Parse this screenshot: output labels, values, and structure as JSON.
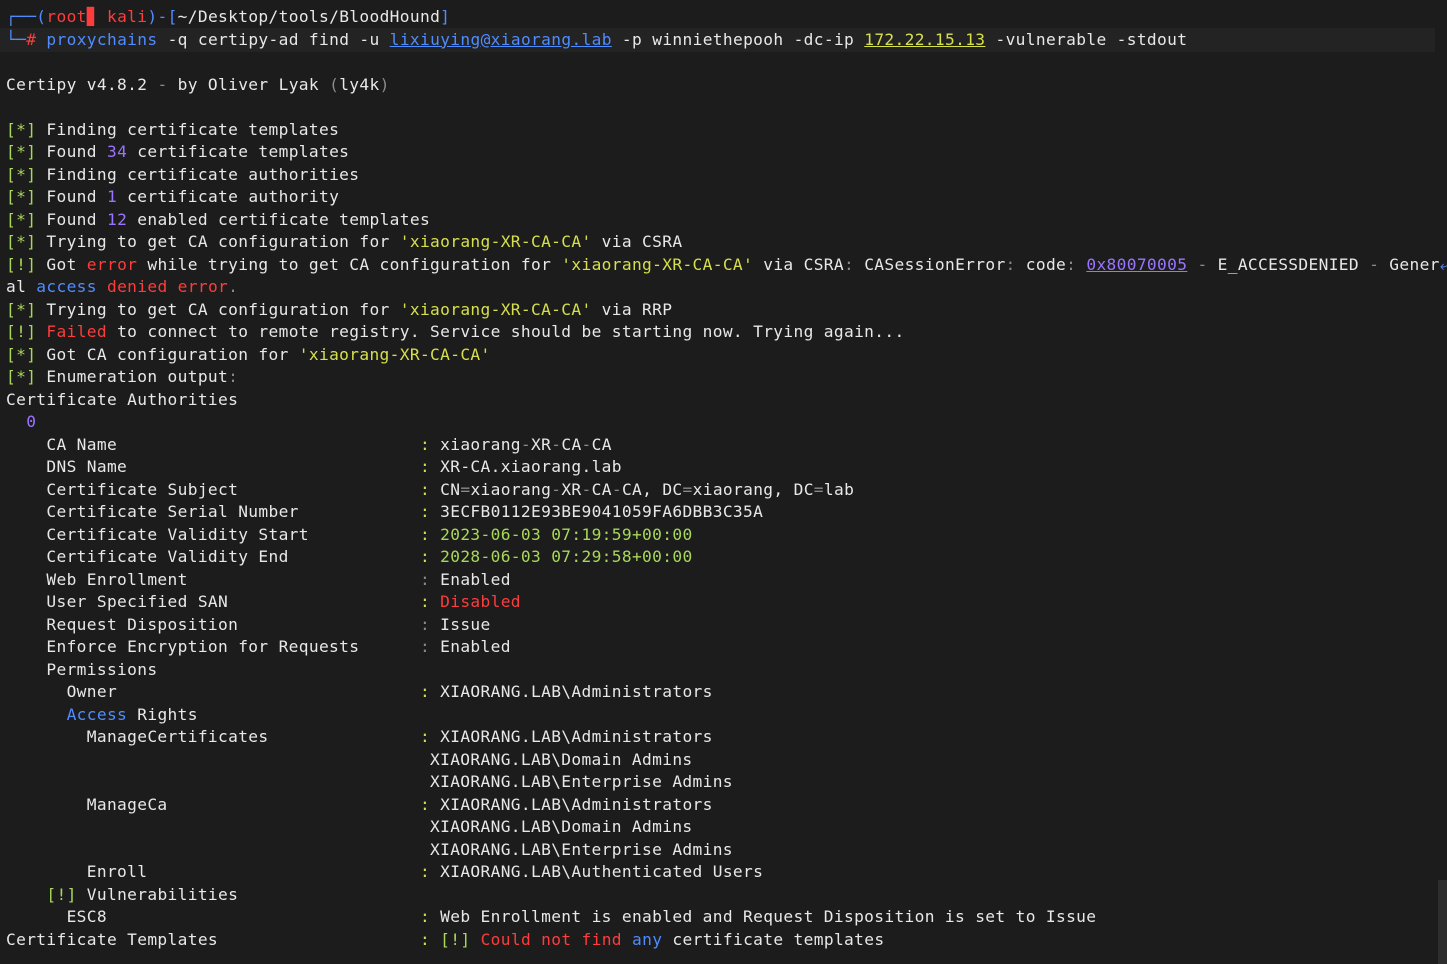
{
  "colors": {
    "background": "#1c1c1c",
    "foreground": "#e8e8e8",
    "blue": "#4f8cff",
    "green": "#a8d85a",
    "red": "#ff3c3c",
    "yellow": "#d6e04a",
    "purple": "#9a74ff",
    "gray": "#8a8a8a"
  },
  "terminal": {
    "lines": [
      [
        {
          "t": "┌──(",
          "c": "blue"
        },
        {
          "t": "root",
          "c": "red"
        },
        {
          "t": "▊",
          "c": "red"
        },
        {
          "t": " kali",
          "c": "red"
        },
        {
          "t": ")-[",
          "c": "blue"
        },
        {
          "t": "~/Desktop/tools/BloodHound",
          "c": "fg"
        },
        {
          "t": "]",
          "c": "blue"
        }
      ],
      [
        {
          "t": "└─",
          "c": "blue"
        },
        {
          "t": "# ",
          "c": "red"
        },
        {
          "t": "proxychains",
          "c": "blue"
        },
        {
          "t": " -q ",
          "c": "fg"
        },
        {
          "t": "certipy-ad",
          "c": "fg"
        },
        {
          "t": " find ",
          "c": "fg"
        },
        {
          "t": "-u",
          "c": "fg"
        },
        {
          "t": " ",
          "c": "fg"
        },
        {
          "t": "lixiuying@xiaorang.lab",
          "c": "blue",
          "u": true
        },
        {
          "t": " -p ",
          "c": "fg"
        },
        {
          "t": "winniethepooh",
          "c": "fg"
        },
        {
          "t": " -dc-ip ",
          "c": "fg"
        },
        {
          "t": "172.22.15.13",
          "c": "yellow",
          "u": true
        },
        {
          "t": " -vulnerable -stdout",
          "c": "fg"
        }
      ],
      [],
      [
        {
          "t": "Certipy v4.8.2 ",
          "c": "fg"
        },
        {
          "t": "-",
          "c": "gray"
        },
        {
          "t": " by Oliver Lyak ",
          "c": "fg"
        },
        {
          "t": "(",
          "c": "gray"
        },
        {
          "t": "ly4k",
          "c": "fg"
        },
        {
          "t": ")",
          "c": "gray"
        }
      ],
      [],
      [
        {
          "t": "[*]",
          "c": "green"
        },
        {
          "t": " Finding certificate templates",
          "c": "fg"
        }
      ],
      [
        {
          "t": "[*]",
          "c": "green"
        },
        {
          "t": " Found ",
          "c": "fg"
        },
        {
          "t": "34",
          "c": "purple"
        },
        {
          "t": " certificate templates",
          "c": "fg"
        }
      ],
      [
        {
          "t": "[*]",
          "c": "green"
        },
        {
          "t": " Finding certificate authorities",
          "c": "fg"
        }
      ],
      [
        {
          "t": "[*]",
          "c": "green"
        },
        {
          "t": " Found ",
          "c": "fg"
        },
        {
          "t": "1",
          "c": "purple"
        },
        {
          "t": " certificate authority",
          "c": "fg"
        }
      ],
      [
        {
          "t": "[*]",
          "c": "green"
        },
        {
          "t": " Found ",
          "c": "fg"
        },
        {
          "t": "12",
          "c": "purple"
        },
        {
          "t": " enabled certificate templates",
          "c": "fg"
        }
      ],
      [
        {
          "t": "[*]",
          "c": "green"
        },
        {
          "t": " Trying to get CA configuration for ",
          "c": "fg"
        },
        {
          "t": "'xiaorang-XR-CA-CA'",
          "c": "yellow"
        },
        {
          "t": " via CSRA",
          "c": "fg"
        }
      ],
      [
        {
          "t": "[!]",
          "c": "green"
        },
        {
          "t": " Got ",
          "c": "fg"
        },
        {
          "t": "error",
          "c": "red"
        },
        {
          "t": " while trying to get CA configuration for ",
          "c": "fg"
        },
        {
          "t": "'xiaorang-XR-CA-CA'",
          "c": "yellow"
        },
        {
          "t": " via CSRA",
          "c": "fg"
        },
        {
          "t": ":",
          "c": "gray"
        },
        {
          "t": " CASessionError",
          "c": "fg"
        },
        {
          "t": ":",
          "c": "gray"
        },
        {
          "t": " code",
          "c": "fg"
        },
        {
          "t": ":",
          "c": "gray"
        },
        {
          "t": " ",
          "c": "fg"
        },
        {
          "t": "0x80070005",
          "c": "purple",
          "u": true
        },
        {
          "t": " ",
          "c": "fg"
        },
        {
          "t": "-",
          "c": "gray"
        },
        {
          "t": " E_ACCESSDENIED ",
          "c": "fg"
        },
        {
          "t": "-",
          "c": "gray"
        },
        {
          "t": " Gener",
          "c": "fg"
        },
        {
          "t": "⤶",
          "c": "blue"
        }
      ],
      [
        {
          "t": "al ",
          "c": "fg"
        },
        {
          "t": "access",
          "c": "blue"
        },
        {
          "t": " ",
          "c": "fg"
        },
        {
          "t": "denied",
          "c": "red"
        },
        {
          "t": " ",
          "c": "fg"
        },
        {
          "t": "error",
          "c": "red"
        },
        {
          "t": ".",
          "c": "gray"
        }
      ],
      [
        {
          "t": "[*]",
          "c": "green"
        },
        {
          "t": " Trying to get CA configuration for ",
          "c": "fg"
        },
        {
          "t": "'xiaorang-XR-CA-CA'",
          "c": "yellow"
        },
        {
          "t": " via RRP",
          "c": "fg"
        }
      ],
      [
        {
          "t": "[!]",
          "c": "green"
        },
        {
          "t": " ",
          "c": "fg"
        },
        {
          "t": "Failed",
          "c": "red"
        },
        {
          "t": " to connect to remote registry. Service should be starting now. Trying again...",
          "c": "fg"
        }
      ],
      [
        {
          "t": "[*]",
          "c": "green"
        },
        {
          "t": " Got CA configuration for ",
          "c": "fg"
        },
        {
          "t": "'xiaorang-XR-CA-CA'",
          "c": "yellow"
        }
      ],
      [
        {
          "t": "[*]",
          "c": "green"
        },
        {
          "t": " Enumeration output",
          "c": "fg"
        },
        {
          "t": ":",
          "c": "gray"
        }
      ],
      [
        {
          "t": "Certificate Authorities",
          "c": "fg"
        }
      ],
      [
        {
          "t": "  ",
          "c": "fg"
        },
        {
          "t": "0",
          "c": "purple"
        }
      ],
      [
        {
          "t": "    CA Name                              ",
          "c": "fg"
        },
        {
          "t": ":",
          "c": "yellow"
        },
        {
          "t": " xiaorang",
          "c": "fg"
        },
        {
          "t": "-",
          "c": "gray"
        },
        {
          "t": "XR",
          "c": "fg"
        },
        {
          "t": "-",
          "c": "gray"
        },
        {
          "t": "CA",
          "c": "fg"
        },
        {
          "t": "-",
          "c": "gray"
        },
        {
          "t": "CA",
          "c": "fg"
        }
      ],
      [
        {
          "t": "    DNS Name                             ",
          "c": "fg"
        },
        {
          "t": ":",
          "c": "yellow"
        },
        {
          "t": " XR-CA.xiaorang.lab",
          "c": "fg"
        }
      ],
      [
        {
          "t": "    Certificate Subject                  ",
          "c": "fg"
        },
        {
          "t": ":",
          "c": "yellow"
        },
        {
          "t": " CN",
          "c": "fg"
        },
        {
          "t": "=",
          "c": "gray"
        },
        {
          "t": "xiaorang",
          "c": "fg"
        },
        {
          "t": "-",
          "c": "gray"
        },
        {
          "t": "XR",
          "c": "fg"
        },
        {
          "t": "-",
          "c": "gray"
        },
        {
          "t": "CA",
          "c": "fg"
        },
        {
          "t": "-",
          "c": "gray"
        },
        {
          "t": "CA, DC",
          "c": "fg"
        },
        {
          "t": "=",
          "c": "gray"
        },
        {
          "t": "xiaorang, DC",
          "c": "fg"
        },
        {
          "t": "=",
          "c": "gray"
        },
        {
          "t": "lab",
          "c": "fg"
        }
      ],
      [
        {
          "t": "    Certificate Serial Number            ",
          "c": "fg"
        },
        {
          "t": ":",
          "c": "yellow"
        },
        {
          "t": " 3ECFB0112E93BE9041059FA6DBB3C35A",
          "c": "fg"
        }
      ],
      [
        {
          "t": "    Certificate Validity Start           ",
          "c": "fg"
        },
        {
          "t": ":",
          "c": "yellow"
        },
        {
          "t": " 2023-06-03 07:19:59+00:00",
          "c": "green"
        }
      ],
      [
        {
          "t": "    Certificate Validity End             ",
          "c": "fg"
        },
        {
          "t": ":",
          "c": "yellow"
        },
        {
          "t": " 2028-06-03 07:29:58+00:00",
          "c": "green"
        }
      ],
      [
        {
          "t": "    Web Enrollment                       ",
          "c": "fg"
        },
        {
          "t": ":",
          "c": "gray"
        },
        {
          "t": " Enabled",
          "c": "fg"
        }
      ],
      [
        {
          "t": "    User Specified SAN                   ",
          "c": "fg"
        },
        {
          "t": ":",
          "c": "yellow"
        },
        {
          "t": " Disabled",
          "c": "red"
        }
      ],
      [
        {
          "t": "    Request Disposition                  ",
          "c": "fg"
        },
        {
          "t": ":",
          "c": "gray"
        },
        {
          "t": " Issue",
          "c": "fg"
        }
      ],
      [
        {
          "t": "    Enforce Encryption for Requests      ",
          "c": "fg"
        },
        {
          "t": ":",
          "c": "gray"
        },
        {
          "t": " Enabled",
          "c": "fg"
        }
      ],
      [
        {
          "t": "    Permissions",
          "c": "fg"
        }
      ],
      [
        {
          "t": "      Owner                              ",
          "c": "fg"
        },
        {
          "t": ":",
          "c": "yellow"
        },
        {
          "t": " XIAORANG.LAB\\Administrators",
          "c": "fg"
        }
      ],
      [
        {
          "t": "      ",
          "c": "fg"
        },
        {
          "t": "Access",
          "c": "blue"
        },
        {
          "t": " Rights",
          "c": "fg"
        }
      ],
      [
        {
          "t": "        ManageCertificates               ",
          "c": "fg"
        },
        {
          "t": ":",
          "c": "yellow"
        },
        {
          "t": " XIAORANG.LAB\\Administrators",
          "c": "fg"
        }
      ],
      [
        {
          "t": "                                          XIAORANG.LAB\\Domain Admins",
          "c": "fg"
        }
      ],
      [
        {
          "t": "                                          XIAORANG.LAB\\Enterprise Admins",
          "c": "fg"
        }
      ],
      [
        {
          "t": "        ManageCa                         ",
          "c": "fg"
        },
        {
          "t": ":",
          "c": "yellow"
        },
        {
          "t": " XIAORANG.LAB\\Administrators",
          "c": "fg"
        }
      ],
      [
        {
          "t": "                                          XIAORANG.LAB\\Domain Admins",
          "c": "fg"
        }
      ],
      [
        {
          "t": "                                          XIAORANG.LAB\\Enterprise Admins",
          "c": "fg"
        }
      ],
      [
        {
          "t": "        Enroll                           ",
          "c": "fg"
        },
        {
          "t": ":",
          "c": "yellow"
        },
        {
          "t": " XIAORANG.LAB\\Authenticated Users",
          "c": "fg"
        }
      ],
      [
        {
          "t": "    ",
          "c": "fg"
        },
        {
          "t": "[!]",
          "c": "green"
        },
        {
          "t": " Vulnerabilities",
          "c": "fg"
        }
      ],
      [
        {
          "t": "      ESC8                               ",
          "c": "fg"
        },
        {
          "t": ":",
          "c": "yellow"
        },
        {
          "t": " Web Enrollment is enabled and Request Disposition is set to Issue",
          "c": "fg"
        }
      ],
      [
        {
          "t": "Certificate Templates                    ",
          "c": "fg"
        },
        {
          "t": ":",
          "c": "yellow"
        },
        {
          "t": " ",
          "c": "fg"
        },
        {
          "t": "[!]",
          "c": "green"
        },
        {
          "t": " ",
          "c": "fg"
        },
        {
          "t": "Could not find",
          "c": "red"
        },
        {
          "t": " ",
          "c": "fg"
        },
        {
          "t": "any",
          "c": "blue"
        },
        {
          "t": " certificate templates",
          "c": "fg"
        }
      ]
    ]
  }
}
